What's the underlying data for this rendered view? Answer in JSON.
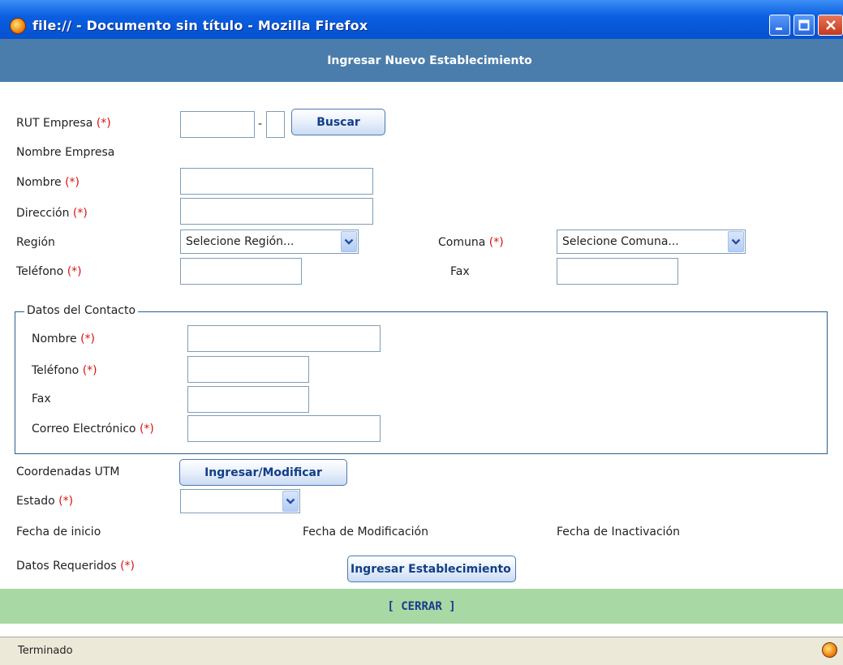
{
  "window": {
    "title": "file:// - Documento sin título - Mozilla Firefox"
  },
  "header": {
    "title": "Ingresar Nuevo Establecimiento"
  },
  "form": {
    "required_mark": "(*)",
    "rut_label": "RUT Empresa",
    "rut_separator": "-",
    "rut_value": "",
    "rut_dv_value": "",
    "search_button": "Buscar",
    "company_name_label": "Nombre Empresa",
    "name_label": "Nombre",
    "name_value": "",
    "address_label": "Dirección",
    "address_value": "",
    "region_label": "Región",
    "region_selected": "Selecione Región...",
    "commune_label": "Comuna",
    "commune_selected": "Selecione Comuna...",
    "phone_label": "Teléfono",
    "phone_value": "",
    "fax_label": "Fax",
    "fax_value": "",
    "contact": {
      "legend": "Datos del Contacto",
      "name_label": "Nombre",
      "name_value": "",
      "phone_label": "Teléfono",
      "phone_value": "",
      "fax_label": "Fax",
      "fax_value": "",
      "email_label": "Correo Electrónico",
      "email_value": ""
    },
    "utm_label": "Coordenadas UTM",
    "utm_button": "Ingresar/Modificar",
    "status_label": "Estado",
    "status_selected": "",
    "start_date_label": "Fecha de inicio",
    "modified_date_label": "Fecha de Modificación",
    "inactivation_date_label": "Fecha de Inactivación",
    "required_note_label": "Datos Requeridos",
    "submit_button": "Ingresar Establecimiento"
  },
  "footer": {
    "close_link": "[ CERRAR ]"
  },
  "statusbar": {
    "text": "Terminado"
  },
  "icons": {
    "app": "firefox-icon",
    "minimize": "minimize-icon",
    "maximize": "maximize-icon",
    "close": "close-icon",
    "dropdown": "chevron-down-icon",
    "status": "firefox-status-icon"
  },
  "colors": {
    "titlebar": "#0a5fe0",
    "header_band": "#4a7dab",
    "close_band": "#a8d8a4",
    "required": "#dd1111",
    "statusbar": "#ece9d8"
  }
}
